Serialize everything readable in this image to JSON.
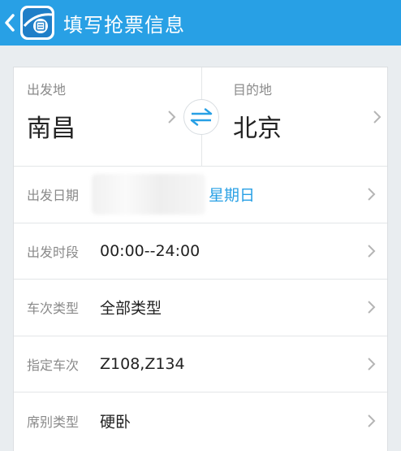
{
  "header": {
    "title": "填写抢票信息",
    "accent_color": "#28a0e5"
  },
  "route": {
    "from_label": "出发地",
    "from_city": "南昌",
    "to_label": "目的地",
    "to_city": "北京"
  },
  "rows": {
    "date": {
      "label": "出发日期",
      "weekday": "星期日"
    },
    "time": {
      "label": "出发时段",
      "value": "00:00--24:00"
    },
    "train_type": {
      "label": "车次类型",
      "value": "全部类型"
    },
    "train_no": {
      "label": "指定车次",
      "value": "Z108,Z134"
    },
    "seat_type": {
      "label": "席别类型",
      "value": "硬卧"
    }
  }
}
